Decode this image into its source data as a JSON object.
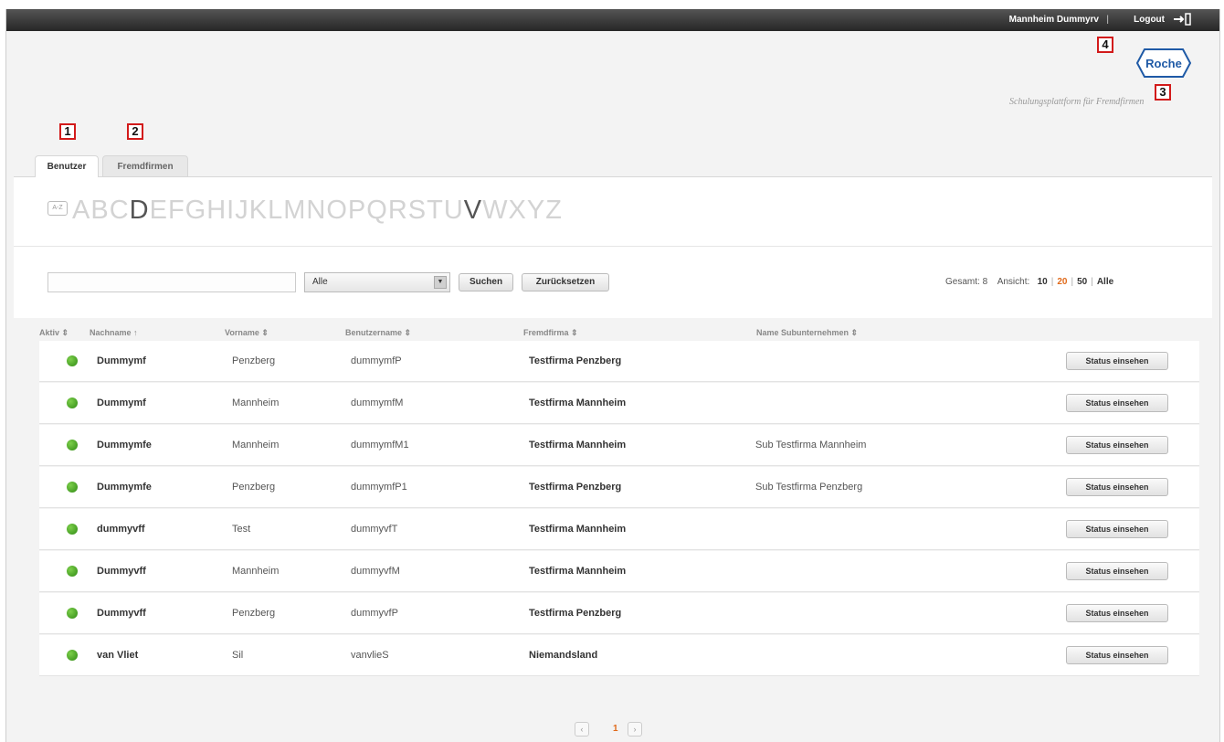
{
  "topbar": {
    "user_name": "Mannheim Dummyrv",
    "separator": "|",
    "logout_label": "Logout",
    "logout_icon": "logout-icon"
  },
  "markers": [
    "1",
    "2",
    "3",
    "4"
  ],
  "logo": {
    "text": "Roche",
    "tagline": "Schulungsplattform für Fremdfirmen",
    "color": "#1f5aa6"
  },
  "tabs": [
    {
      "label": "Benutzer",
      "active": true
    },
    {
      "label": "Fremdfirmen",
      "active": false
    }
  ],
  "alphabet": {
    "icon_label": "A-Z",
    "letters": [
      "A",
      "B",
      "C",
      "D",
      "E",
      "F",
      "G",
      "H",
      "I",
      "J",
      "K",
      "L",
      "M",
      "N",
      "O",
      "P",
      "Q",
      "R",
      "S",
      "T",
      "U",
      "V",
      "W",
      "X",
      "Y",
      "Z"
    ],
    "active_letters": [
      "D",
      "V"
    ]
  },
  "filter": {
    "search_value": "",
    "select_value": "Alle",
    "search_button": "Suchen",
    "reset_button": "Zurücksetzen",
    "total_label": "Gesamt:",
    "total_value": "8",
    "view_label": "Ansicht:",
    "view_options": [
      "10",
      "20",
      "50",
      "Alle"
    ],
    "view_current": "20",
    "accent_color": "#e06a1b"
  },
  "table": {
    "headers": {
      "aktiv": "Aktiv ⇕",
      "nachname": "Nachname ↑",
      "vorname": "Vorname ⇕",
      "benutzername": "Benutzername ⇕",
      "fremdfirma": "Fremdfirma ⇕",
      "sub": "Name Subunternehmen ⇕"
    },
    "action_label": "Status einsehen",
    "rows": [
      {
        "nachname": "Dummymf",
        "vorname": "Penzberg",
        "benutzername": "dummymfP",
        "fremdfirma": "Testfirma Penzberg",
        "sub": ""
      },
      {
        "nachname": "Dummymf",
        "vorname": "Mannheim",
        "benutzername": "dummymfM",
        "fremdfirma": "Testfirma Mannheim",
        "sub": ""
      },
      {
        "nachname": "Dummymfe",
        "vorname": "Mannheim",
        "benutzername": "dummymfM1",
        "fremdfirma": "Testfirma Mannheim",
        "sub": "Sub Testfirma Mannheim"
      },
      {
        "nachname": "Dummymfe",
        "vorname": "Penzberg",
        "benutzername": "dummymfP1",
        "fremdfirma": "Testfirma Penzberg",
        "sub": "Sub Testfirma Penzberg"
      },
      {
        "nachname": "dummyvff",
        "vorname": "Test",
        "benutzername": "dummyvfT",
        "fremdfirma": "Testfirma Mannheim",
        "sub": ""
      },
      {
        "nachname": "Dummyvff",
        "vorname": "Mannheim",
        "benutzername": "dummyvfM",
        "fremdfirma": "Testfirma Mannheim",
        "sub": ""
      },
      {
        "nachname": "Dummyvff",
        "vorname": "Penzberg",
        "benutzername": "dummyvfP",
        "fremdfirma": "Testfirma Penzberg",
        "sub": ""
      },
      {
        "nachname": "van Vliet",
        "vorname": "Sil",
        "benutzername": "vanvlieS",
        "fremdfirma": "Niemandsland",
        "sub": ""
      }
    ]
  },
  "pager": {
    "prev": "‹",
    "current": "1",
    "next": "›"
  }
}
